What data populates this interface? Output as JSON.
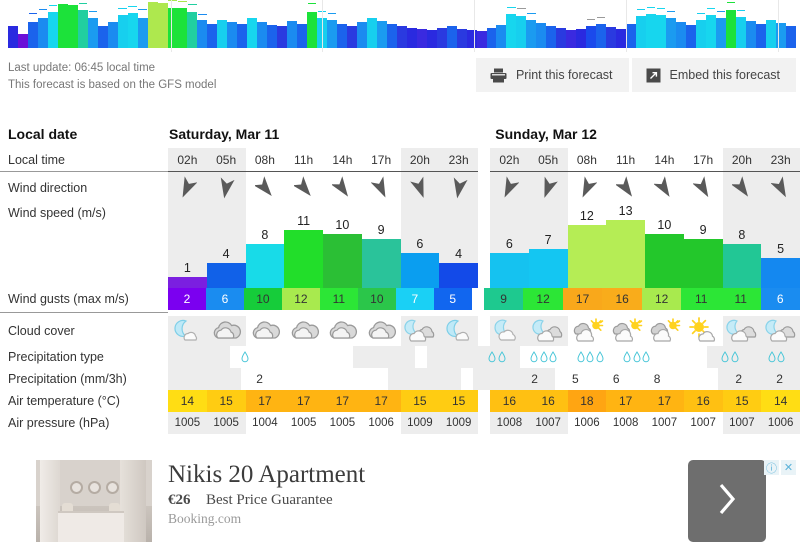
{
  "update": {
    "last_update": "Last update: 06:45 local time",
    "model_note": "This forecast is based on the GFS model"
  },
  "actions": {
    "print": {
      "label": "Print this forecast",
      "icon": "printer-icon"
    },
    "embed": {
      "label": "Embed this forecast",
      "icon": "embed-arrow-icon"
    }
  },
  "rows": {
    "local_date": "Local date",
    "local_time": "Local time",
    "wind_direction": "Wind direction",
    "wind_speed": "Wind speed  (m/s)",
    "wind_gusts": "Wind gusts  (max m/s)",
    "cloud_cover": "Cloud cover",
    "precip_type": "Precipitation type",
    "precip_amount": "Precipitation  (mm/3h)",
    "air_temperature": "Air temperature  (°C)",
    "air_pressure": "Air pressure  (hPa)"
  },
  "colors": {
    "shade": "#ededed",
    "drop": "#49c6d8",
    "sun": "#ffd21e",
    "cloud_grey": "#b9b9b9",
    "cloud_blue": "#8fd8ef"
  },
  "days": [
    {
      "name": "Saturday, Mar 11",
      "columns": [
        {
          "time": "02h",
          "shaded": true,
          "wind_dir_deg": 205,
          "wind_speed": 1,
          "wind_speed_color": "#7b1fe0",
          "gust": 2,
          "gust_color": "#7b00f0",
          "gust_text": "#ffffff",
          "cloud": "moon-cloud",
          "drops": 0,
          "precip": "",
          "temp": 14,
          "temp_color": "#ffdd14",
          "pressure": 1005
        },
        {
          "time": "05h",
          "shaded": true,
          "wind_dir_deg": 190,
          "wind_speed": 4,
          "wind_speed_color": "#1161e8",
          "gust": 6,
          "gust_color": "#1a8cf0",
          "gust_text": "#ffffff",
          "cloud": "cloud-grey",
          "drops": 0,
          "precip": "",
          "temp": 15,
          "temp_color": "#ffcc12",
          "pressure": 1005
        },
        {
          "time": "08h",
          "shaded": false,
          "wind_dir_deg": 140,
          "wind_speed": 8,
          "wind_speed_color": "#18dbe8",
          "gust": 10,
          "gust_color": "#16cc3a",
          "gust_text": "#333333",
          "cloud": "cloud-grey",
          "drops": 1,
          "precip": "2",
          "temp": 17,
          "temp_color": "#ffb412",
          "pressure": 1004
        },
        {
          "time": "11h",
          "shaded": false,
          "wind_dir_deg": 140,
          "wind_speed": 11,
          "wind_speed_color": "#22de2a",
          "gust": 12,
          "gust_color": "#a8ea4e",
          "gust_text": "#333333",
          "cloud": "cloud-grey",
          "drops": 0,
          "precip": "",
          "temp": 17,
          "temp_color": "#ffb412",
          "pressure": 1005
        },
        {
          "time": "14h",
          "shaded": false,
          "wind_dir_deg": 145,
          "wind_speed": 10,
          "wind_speed_color": "#2bbf35",
          "gust": 11,
          "gust_color": "#2ce636",
          "gust_text": "#333333",
          "cloud": "cloud-grey",
          "drops": 0,
          "precip": "",
          "temp": 17,
          "temp_color": "#ffb412",
          "pressure": 1005
        },
        {
          "time": "17h",
          "shaded": false,
          "wind_dir_deg": 155,
          "wind_speed": 9,
          "wind_speed_color": "#2ac39a",
          "gust": 10,
          "gust_color": "#2bc64a",
          "gust_text": "#333333",
          "cloud": "cloud-grey",
          "drops": 0,
          "precip": "",
          "temp": 17,
          "temp_color": "#ffb412",
          "pressure": 1006
        },
        {
          "time": "20h",
          "shaded": true,
          "wind_dir_deg": 160,
          "wind_speed": 6,
          "wind_speed_color": "#0a9ef0",
          "gust": 7,
          "gust_color": "#1ad0f5",
          "gust_text": "#ffffff",
          "cloud": "moon-cloud-mix",
          "drops": 0,
          "precip": "",
          "temp": 15,
          "temp_color": "#ffcc12",
          "pressure": 1009
        },
        {
          "time": "23h",
          "shaded": true,
          "wind_dir_deg": 190,
          "wind_speed": 4,
          "wind_speed_color": "#134ae8",
          "gust": 5,
          "gust_color": "#1166ef",
          "gust_text": "#ffffff",
          "cloud": "moon-cloud",
          "drops": 0,
          "precip": "",
          "temp": 15,
          "temp_color": "#ffcc12",
          "pressure": 1009
        }
      ]
    },
    {
      "name": "Sunday, Mar 12",
      "columns": [
        {
          "time": "02h",
          "shaded": true,
          "wind_dir_deg": 205,
          "wind_speed": 6,
          "wind_speed_color": "#15c2f0",
          "gust": 9,
          "gust_color": "#1ec98f",
          "gust_text": "#333333",
          "cloud": "moon-cloud-blue",
          "drops": 0,
          "precip": "",
          "temp": 16,
          "temp_color": "#ffc012",
          "pressure": 1008
        },
        {
          "time": "05h",
          "shaded": true,
          "wind_dir_deg": 200,
          "wind_speed": 7,
          "wind_speed_color": "#14c6f2",
          "gust": 12,
          "gust_color": "#2ce636",
          "gust_text": "#333333",
          "cloud": "moon-cloud-mix",
          "drops": 2,
          "precip": "2",
          "temp": 16,
          "temp_color": "#ffc012",
          "pressure": 1007
        },
        {
          "time": "08h",
          "shaded": false,
          "wind_dir_deg": 205,
          "wind_speed": 12,
          "wind_speed_color": "#b5ed55",
          "gust": 17,
          "gust_color": "#f9a81b",
          "gust_text": "#333333",
          "cloud": "sun-cloud",
          "drops": 3,
          "precip": "5",
          "temp": 18,
          "temp_color": "#ffa512",
          "pressure": 1006
        },
        {
          "time": "11h",
          "shaded": false,
          "wind_dir_deg": 145,
          "wind_speed": 13,
          "wind_speed_color": "#b5ed55",
          "gust": 16,
          "gust_color": "#f9ac1b",
          "gust_text": "#333333",
          "cloud": "sun-cloud",
          "drops": 3,
          "precip": "6",
          "temp": 17,
          "temp_color": "#ffb412",
          "pressure": 1008
        },
        {
          "time": "14h",
          "shaded": false,
          "wind_dir_deg": 148,
          "wind_speed": 10,
          "wind_speed_color": "#23c72b",
          "gust": 12,
          "gust_color": "#a8ea4e",
          "gust_text": "#333333",
          "cloud": "sun-cloud",
          "drops": 3,
          "precip": "8",
          "temp": 17,
          "temp_color": "#ffb412",
          "pressure": 1007
        },
        {
          "time": "17h",
          "shaded": false,
          "wind_dir_deg": 150,
          "wind_speed": 9,
          "wind_speed_color": "#23c72b",
          "gust": 11,
          "gust_color": "#2ce636",
          "gust_text": "#333333",
          "cloud": "sun-small-cloud",
          "drops": 0,
          "precip": "",
          "temp": 16,
          "temp_color": "#ffc012",
          "pressure": 1007
        },
        {
          "time": "20h",
          "shaded": true,
          "wind_dir_deg": 145,
          "wind_speed": 8,
          "wind_speed_color": "#22c795",
          "gust": 11,
          "gust_color": "#2ce636",
          "gust_text": "#333333",
          "cloud": "moon-cloud-mix",
          "drops": 2,
          "precip": "2",
          "temp": 15,
          "temp_color": "#ffcc12",
          "pressure": 1007
        },
        {
          "time": "23h",
          "shaded": true,
          "wind_dir_deg": 152,
          "wind_speed": 5,
          "wind_speed_color": "#1488f0",
          "gust": 6,
          "gust_color": "#1a8cf0",
          "gust_text": "#ffffff",
          "cloud": "moon-cloud-mix",
          "drops": 2,
          "precip": "2",
          "temp": 14,
          "temp_color": "#ffdd14",
          "pressure": 1006
        }
      ]
    }
  ],
  "overview": {
    "bars": [
      {
        "h": 22,
        "c": "#2a2ae0",
        "t": 0,
        "tc": "#2a2ae0"
      },
      {
        "h": 14,
        "c": "#6a10d8",
        "t": 0,
        "tc": "#6a10d8"
      },
      {
        "h": 26,
        "c": "#1b63ec",
        "t": 34,
        "tc": "#1b63ec"
      },
      {
        "h": 30,
        "c": "#1b8bf0",
        "t": 38,
        "tc": "#1b8bf0"
      },
      {
        "h": 36,
        "c": "#17d6ee",
        "t": 42,
        "tc": "#17d6ee"
      },
      {
        "h": 44,
        "c": "#1ce23a",
        "t": 50,
        "tc": "#8ee04a"
      },
      {
        "h": 43,
        "c": "#1ce23a",
        "t": 49,
        "tc": "#8ee04a"
      },
      {
        "h": 38,
        "c": "#21cfa0",
        "t": 44,
        "tc": "#21cfa0"
      },
      {
        "h": 30,
        "c": "#1b9bf0",
        "t": 36,
        "tc": "#1b9bf0"
      },
      {
        "h": 22,
        "c": "#1b63ec",
        "t": 0,
        "tc": "#1b63ec"
      },
      {
        "h": 26,
        "c": "#1b8bf0",
        "t": 0,
        "tc": "#1b8bf0"
      },
      {
        "h": 33,
        "c": "#17cfee",
        "t": 39,
        "tc": "#17cfee"
      },
      {
        "h": 35,
        "c": "#17d6ee",
        "t": 41,
        "tc": "#17d6ee"
      },
      {
        "h": 30,
        "c": "#1b9bf0",
        "t": 38,
        "tc": "#1b9bf0"
      },
      {
        "h": 46,
        "c": "#aee84e",
        "t": 56,
        "tc": "#e8b020"
      },
      {
        "h": 45,
        "c": "#aee84e",
        "t": 55,
        "tc": "#e8b020"
      },
      {
        "h": 40,
        "c": "#1ce23a",
        "t": 47,
        "tc": "#a8e84e"
      },
      {
        "h": 40,
        "c": "#1ce23a",
        "t": 46,
        "tc": "#a8e84e"
      },
      {
        "h": 36,
        "c": "#21cfa0",
        "t": 43,
        "tc": "#21cfa0"
      },
      {
        "h": 28,
        "c": "#1b8bf0",
        "t": 33,
        "tc": "#1b8bf0"
      },
      {
        "h": 24,
        "c": "#1b63ec",
        "t": 0,
        "tc": "#1b63ec"
      },
      {
        "h": 28,
        "c": "#17cfee",
        "t": 0,
        "tc": "#17cfee"
      },
      {
        "h": 26,
        "c": "#1b8bf0",
        "t": 0,
        "tc": "#1b8bf0"
      },
      {
        "h": 24,
        "c": "#1b63ec",
        "t": 0,
        "tc": "#1b63ec"
      },
      {
        "h": 30,
        "c": "#17d6ee",
        "t": 0,
        "tc": "#17d6ee"
      },
      {
        "h": 26,
        "c": "#1b8bf0",
        "t": 0,
        "tc": "#1b8bf0"
      },
      {
        "h": 23,
        "c": "#1b63ec",
        "t": 0,
        "tc": "#1b63ec"
      },
      {
        "h": 22,
        "c": "#2a3ae0",
        "t": 0,
        "tc": "#2a3ae0"
      },
      {
        "h": 27,
        "c": "#1b8bf0",
        "t": 0,
        "tc": "#1b8bf0"
      },
      {
        "h": 24,
        "c": "#1b63ec",
        "t": 0,
        "tc": "#1b63ec"
      },
      {
        "h": 36,
        "c": "#1ce23a",
        "t": 44,
        "tc": "#1ce23a"
      },
      {
        "h": 30,
        "c": "#17cfee",
        "t": 36,
        "tc": "#17cfee"
      },
      {
        "h": 28,
        "c": "#1b9bf0",
        "t": 34,
        "tc": "#1b9bf0"
      },
      {
        "h": 24,
        "c": "#1b63ec",
        "t": 0,
        "tc": "#1b63ec"
      },
      {
        "h": 22,
        "c": "#2a3ae0",
        "t": 0,
        "tc": "#2a3ae0"
      },
      {
        "h": 26,
        "c": "#1b8bf0",
        "t": 0,
        "tc": "#1b8bf0"
      },
      {
        "h": 30,
        "c": "#17cfee",
        "t": 0,
        "tc": "#17cfee"
      },
      {
        "h": 27,
        "c": "#1b9bf0",
        "t": 0,
        "tc": "#1b9bf0"
      },
      {
        "h": 24,
        "c": "#1b63ec",
        "t": 0,
        "tc": "#1b63ec"
      },
      {
        "h": 22,
        "c": "#2a3ae0",
        "t": 0,
        "tc": "#2a3ae0"
      },
      {
        "h": 20,
        "c": "#2a2ae0",
        "t": 0,
        "tc": "#2a2ae0"
      },
      {
        "h": 19,
        "c": "#3a2ae0",
        "t": 0,
        "tc": "#3a2ae0"
      },
      {
        "h": 18,
        "c": "#2a2ae0",
        "t": 0,
        "tc": "#2a2ae0"
      },
      {
        "h": 20,
        "c": "#2a3ae0",
        "t": 0,
        "tc": "#2a3ae0"
      },
      {
        "h": 22,
        "c": "#1b63ec",
        "t": 0,
        "tc": "#1b63ec"
      },
      {
        "h": 19,
        "c": "#2a3ae0",
        "t": 0,
        "tc": "#2a3ae0"
      },
      {
        "h": 18,
        "c": "#2a2ae0",
        "t": 0,
        "tc": "#2a2ae0"
      },
      {
        "h": 17,
        "c": "#3a2ae0",
        "t": 0,
        "tc": "#3a2ae0"
      },
      {
        "h": 20,
        "c": "#1b63ec",
        "t": 0,
        "tc": "#1b63ec"
      },
      {
        "h": 23,
        "c": "#1b8bf0",
        "t": 0,
        "tc": "#1b8bf0"
      },
      {
        "h": 34,
        "c": "#17d6ee",
        "t": 40,
        "tc": "#17d6ee"
      },
      {
        "h": 32,
        "c": "#17cfee",
        "t": 39,
        "tc": "#9a9a9a"
      },
      {
        "h": 28,
        "c": "#1b9bf0",
        "t": 34,
        "tc": "#1b9bf0"
      },
      {
        "h": 25,
        "c": "#1b8bf0",
        "t": 0,
        "tc": "#1b8bf0"
      },
      {
        "h": 22,
        "c": "#1b63ec",
        "t": 0,
        "tc": "#1b63ec"
      },
      {
        "h": 20,
        "c": "#2a3ae0",
        "t": 0,
        "tc": "#2a3ae0"
      },
      {
        "h": 18,
        "c": "#3a2ae0",
        "t": 0,
        "tc": "#3a2ae0"
      },
      {
        "h": 19,
        "c": "#2a2ae0",
        "t": 0,
        "tc": "#2a2ae0"
      },
      {
        "h": 22,
        "c": "#1b4aec",
        "t": 28,
        "tc": "#9a9a9a"
      },
      {
        "h": 24,
        "c": "#1b63ec",
        "t": 30,
        "tc": "#9a9a9a"
      },
      {
        "h": 21,
        "c": "#2a3ae0",
        "t": 0,
        "tc": "#2a3ae0"
      },
      {
        "h": 19,
        "c": "#2a2ae0",
        "t": 0,
        "tc": "#2a2ae0"
      },
      {
        "h": 24,
        "c": "#1b63ec",
        "t": 0,
        "tc": "#1b63ec"
      },
      {
        "h": 32,
        "c": "#17cfee",
        "t": 38,
        "tc": "#17cfee"
      },
      {
        "h": 34,
        "c": "#17d6ee",
        "t": 40,
        "tc": "#17d6ee"
      },
      {
        "h": 33,
        "c": "#17d6ee",
        "t": 39,
        "tc": "#17d6ee"
      },
      {
        "h": 30,
        "c": "#1b9bf0",
        "t": 36,
        "tc": "#1b9bf0"
      },
      {
        "h": 26,
        "c": "#1b8bf0",
        "t": 0,
        "tc": "#1b8bf0"
      },
      {
        "h": 23,
        "c": "#1b63ec",
        "t": 0,
        "tc": "#1b63ec"
      },
      {
        "h": 28,
        "c": "#17cfee",
        "t": 34,
        "tc": "#17cfee"
      },
      {
        "h": 33,
        "c": "#17d6ee",
        "t": 39,
        "tc": "#17d6ee"
      },
      {
        "h": 30,
        "c": "#1b9bf0",
        "t": 36,
        "tc": "#1b9bf0"
      },
      {
        "h": 38,
        "c": "#1ce23a",
        "t": 45,
        "tc": "#1ce23a"
      },
      {
        "h": 31,
        "c": "#17cfee",
        "t": 37,
        "tc": "#17cfee"
      },
      {
        "h": 27,
        "c": "#1b8bf0",
        "t": 0,
        "tc": "#1b8bf0"
      },
      {
        "h": 24,
        "c": "#1b63ec",
        "t": 0,
        "tc": "#1b63ec"
      },
      {
        "h": 28,
        "c": "#17cfee",
        "t": 0,
        "tc": "#17cfee"
      },
      {
        "h": 25,
        "c": "#1b9bf0",
        "t": 0,
        "tc": "#1b9bf0"
      },
      {
        "h": 22,
        "c": "#1b63ec",
        "t": 0,
        "tc": "#1b63ec"
      }
    ],
    "day_separators": [
      171,
      322,
      474,
      626,
      778
    ]
  },
  "ad": {
    "title": "Nikis 20 Apartment",
    "price": "€26",
    "guarantee": "Best Price Guarantee",
    "brand": "Booking.com",
    "cta_icon": "chevron-right-icon",
    "info_badge": "ⓘ",
    "close_badge": "✕"
  }
}
